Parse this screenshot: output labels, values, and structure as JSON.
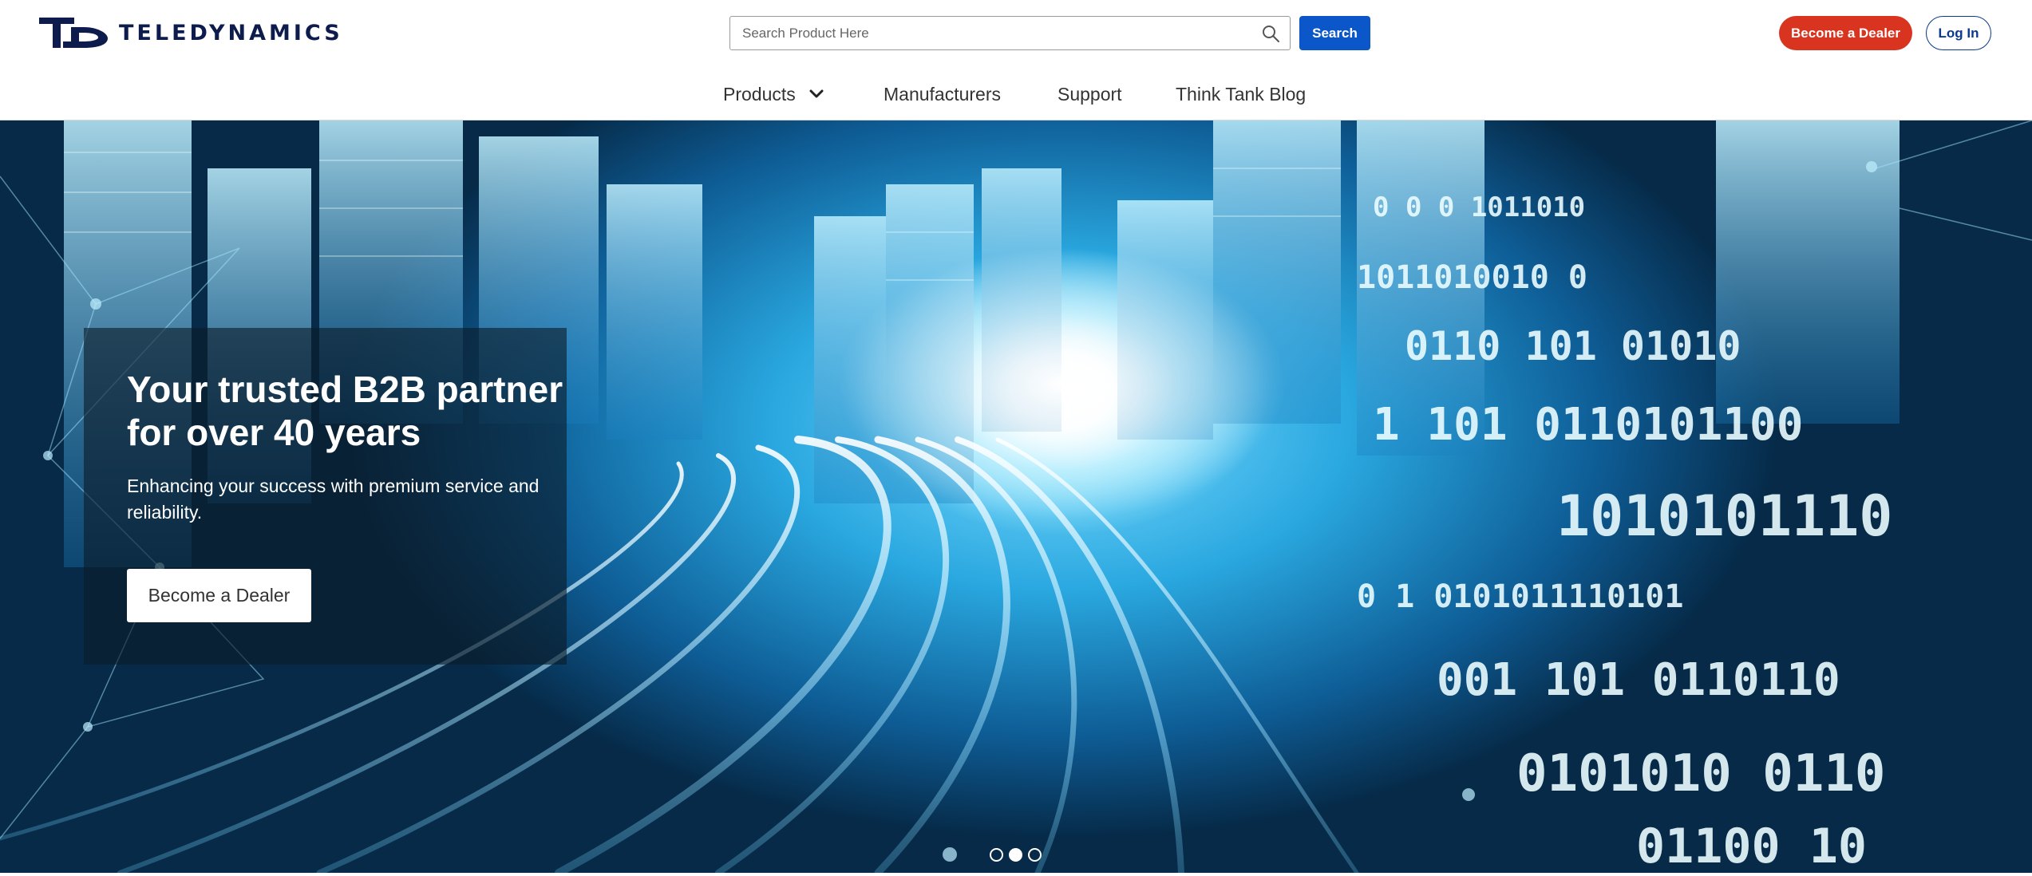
{
  "brand": {
    "name": "TELEDYNAMICS",
    "logo_mark": "TD",
    "color": "#0e1b4d"
  },
  "search": {
    "placeholder": "Search Product Here",
    "value": "",
    "button_label": "Search",
    "icon": "search-icon"
  },
  "account": {
    "dealer_label": "Become a Dealer",
    "login_label": "Log In"
  },
  "nav": {
    "items": [
      {
        "label": "Products",
        "icon": "chevron-down-icon"
      },
      {
        "label": "Manufacturers"
      },
      {
        "label": "Support"
      },
      {
        "label": "Think Tank Blog"
      }
    ]
  },
  "hero": {
    "title": "Your trusted B2B partner for over 40 years",
    "subtitle": "Enhancing your success with premium service and reliability.",
    "cta_label": "Become a Dealer",
    "carousel": {
      "slides": 3,
      "active_index": 1
    }
  },
  "colors": {
    "primary": "#0b57c9",
    "accent": "#d9341f",
    "outline": "#0b3a8c"
  }
}
